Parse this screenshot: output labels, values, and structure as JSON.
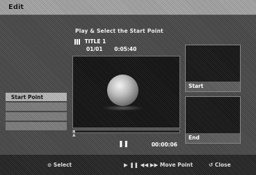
{
  "window": {
    "title": "Edit"
  },
  "heading": "Play & Select the Start Point",
  "title_info": {
    "title": "TITLE 1",
    "chapter": "01/01",
    "time": "0:05:40"
  },
  "menu": {
    "items": [
      {
        "label": "Start Point",
        "selected": true
      },
      {
        "label": "",
        "selected": false
      },
      {
        "label": "",
        "selected": false
      },
      {
        "label": "",
        "selected": false
      }
    ]
  },
  "playback": {
    "status_icon": "pause-icon",
    "time": "00:00:06",
    "progress": 0.02
  },
  "thumbnails": {
    "start_label": "Start",
    "end_label": "End"
  },
  "guide": {
    "select": "Select",
    "move": "Move Point",
    "close": "Close"
  },
  "colors": {
    "menu_selected": "#c4c4c4",
    "background": "#000000"
  }
}
